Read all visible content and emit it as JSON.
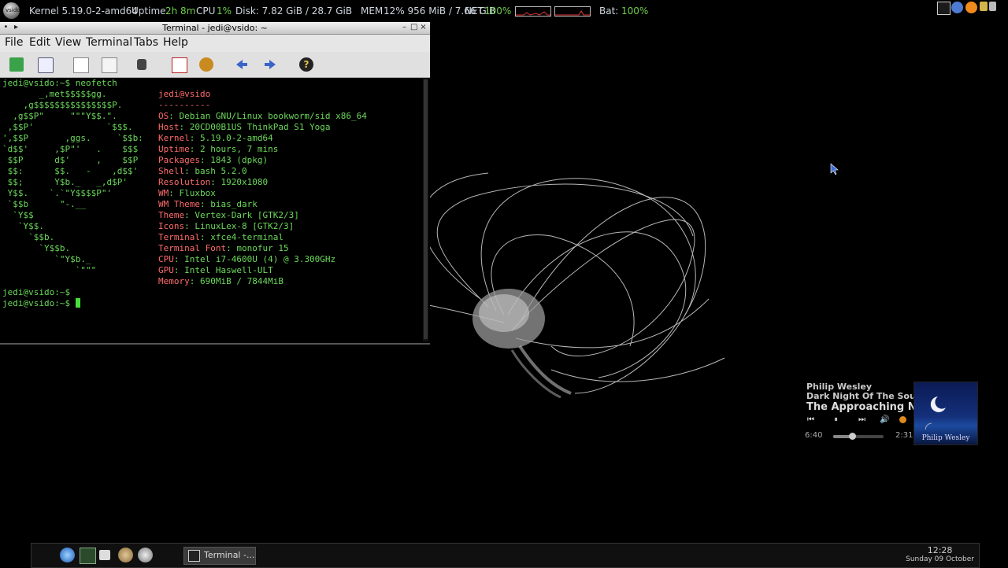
{
  "topbar": {
    "kernel": "Kernel 5.19.0-2-amd64",
    "uptime_label": "Uptime",
    "uptime_value": "2h 8m",
    "cpu_label": "CPU",
    "cpu_value": "1%",
    "disk": "Disk: 7.82 GiB / 28.7 GiB",
    "mem_label": "MEM",
    "mem_value": "12% 956 MiB / 7.66 GiB",
    "net_label": "NET",
    "net_value": "100%",
    "bat_label": "Bat:",
    "bat_value": "100%",
    "logo_text": "vsido"
  },
  "terminal": {
    "title": "Terminal - jedi@vsido: ~",
    "menu": [
      "File",
      "Edit",
      "View",
      "Terminal",
      "Tabs",
      "Help"
    ],
    "prompt1": "jedi@vsido:~$ neofetch",
    "logo": [
      "       _,met$$$$$gg.",
      "    ,g$$$$$$$$$$$$$$$P.",
      "  ,g$$P\"     \"\"\"Y$$.\".",
      " ,$$P'              `$$$.",
      "',$$P       ,ggs.     `$$b:",
      "`d$$'     ,$P\"'   .    $$$",
      " $$P      d$'     ,    $$P",
      " $$:      $$.   -    ,d$$'",
      " $$;      Y$b._   _,d$P'",
      " Y$$.    `.`\"Y$$$$P\"'",
      " `$$b      \"-.__",
      "  `Y$$",
      "   `Y$$.",
      "     `$$b.",
      "       `Y$$b.",
      "          `\"Y$b._",
      "              `\"\"\""
    ],
    "user_host": "jedi@vsido",
    "separator": "----------",
    "info": [
      {
        "label": "OS",
        "value": ": Debian GNU/Linux bookworm/sid x86_64"
      },
      {
        "label": "Host",
        "value": ": 20CD00B1US ThinkPad S1 Yoga"
      },
      {
        "label": "Kernel",
        "value": ": 5.19.0-2-amd64"
      },
      {
        "label": "Uptime",
        "value": ": 2 hours, 7 mins"
      },
      {
        "label": "Packages",
        "value": ": 1843 (dpkg)"
      },
      {
        "label": "Shell",
        "value": ": bash 5.2.0"
      },
      {
        "label": "Resolution",
        "value": ": 1920x1080"
      },
      {
        "label": "WM",
        "value": ": Fluxbox"
      },
      {
        "label": "WM Theme",
        "value": ": bias_dark"
      },
      {
        "label": "Theme",
        "value": ": Vertex-Dark [GTK2/3]"
      },
      {
        "label": "Icons",
        "value": ": LinuxLex-8 [GTK2/3]"
      },
      {
        "label": "Terminal",
        "value": ": xfce4-terminal"
      },
      {
        "label": "Terminal Font",
        "value": ": monofur 15"
      },
      {
        "label": "CPU",
        "value": ": Intel i7-4600U (4) @ 3.300GHz"
      },
      {
        "label": "GPU",
        "value": ": Intel Haswell-ULT"
      },
      {
        "label": "Memory",
        "value": ": 690MiB / 7844MiB"
      }
    ],
    "prompt2": "jedi@vsido:~$",
    "prompt3": "jedi@vsido:~$ "
  },
  "music": {
    "artist": "Philip Wesley",
    "album": "Dark Night Of The Soul",
    "song": "The Approaching Night",
    "elapsed": "6:40",
    "remaining": "2:31",
    "progress": 0.37,
    "cover_caption": "Philip Wesley"
  },
  "taskbar": {
    "task_label": "Terminal -...",
    "clock_time": "12:28",
    "clock_date": "Sunday 09 October"
  }
}
